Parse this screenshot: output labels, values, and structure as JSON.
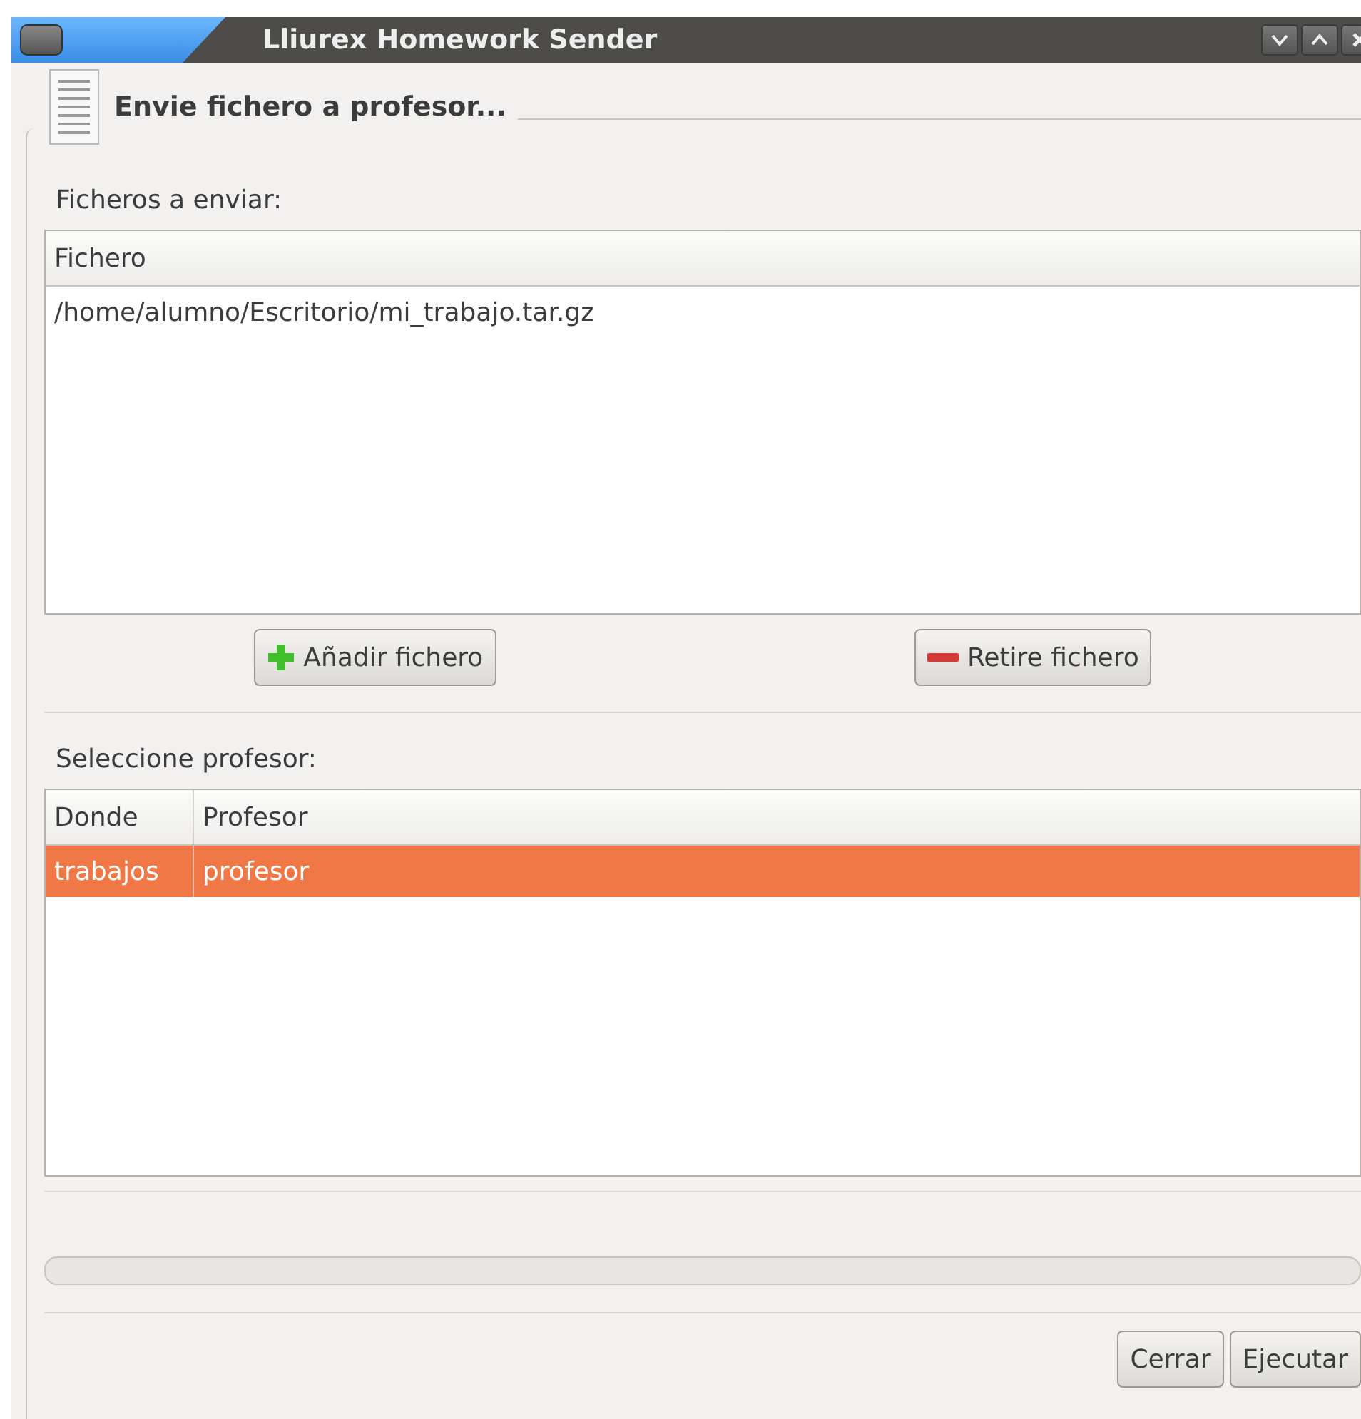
{
  "window": {
    "title": "Lliurex Homework Sender"
  },
  "header": {
    "title": "Envie fichero a profesor..."
  },
  "files": {
    "label": "Ficheros a enviar:",
    "columns": [
      "Fichero"
    ],
    "rows": [
      {
        "cells": [
          "/home/alumno/Escritorio/mi_trabajo.tar.gz"
        ],
        "selected": false
      }
    ]
  },
  "file_buttons": [
    {
      "kind": "add",
      "label": "Añadir fichero"
    },
    {
      "kind": "remove",
      "label": "Retire fichero"
    }
  ],
  "teachers": {
    "label": "Seleccione profesor:",
    "columns": [
      "Donde",
      "Profesor"
    ],
    "rows": [
      {
        "cells": [
          "trabajos",
          "profesor"
        ],
        "selected": true
      }
    ]
  },
  "progress": {
    "level": 0
  },
  "buttons": [
    "Cerrar",
    "Ejecutar"
  ]
}
